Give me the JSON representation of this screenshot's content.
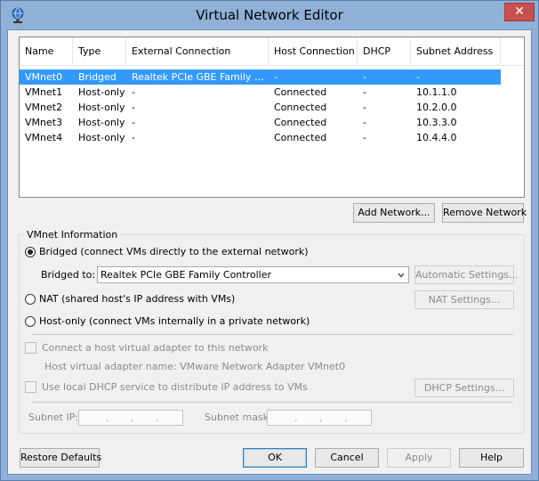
{
  "window": {
    "title": "Virtual Network Editor",
    "close_glyph": "✕"
  },
  "list": {
    "headers": [
      "Name",
      "Type",
      "External Connection",
      "Host Connection",
      "DHCP",
      "Subnet Address"
    ],
    "rows": [
      [
        "VMnet0",
        "Bridged",
        "Realtek PCIe GBE Family Co...",
        "-",
        "-",
        "-"
      ],
      [
        "VMnet1",
        "Host-only",
        "-",
        "Connected",
        "-",
        "10.1.1.0"
      ],
      [
        "VMnet2",
        "Host-only",
        "-",
        "Connected",
        "-",
        "10.2.0.0"
      ],
      [
        "VMnet3",
        "Host-only",
        "-",
        "Connected",
        "-",
        "10.3.3.0"
      ],
      [
        "VMnet4",
        "Host-only",
        "-",
        "Connected",
        "-",
        "10.4.4.0"
      ]
    ],
    "selected_row": 0
  },
  "buttons": {
    "add_network": "Add Network...",
    "remove_network": "Remove Network",
    "restore_defaults": "Restore Defaults",
    "ok": "OK",
    "cancel": "Cancel",
    "apply": "Apply",
    "help": "Help"
  },
  "vmnet_info": {
    "label": "VMnet Information",
    "bridged_label": "Bridged (connect VMs directly to the external network)",
    "bridged_to_label": "Bridged to:",
    "bridged_to_value": "Realtek PCIe GBE Family Controller",
    "automatic_settings": "Automatic Settings...",
    "nat_label": "NAT (shared host's IP address with VMs)",
    "nat_settings": "NAT Settings...",
    "hostonly_label": "Host-only (connect VMs internally in a private network)",
    "connect_adapter_label": "Connect a host virtual adapter to this network",
    "adapter_name_label": "Host virtual adapter name: VMware Network Adapter VMnet0",
    "dhcp_label": "Use local DHCP service to distribute IP address to VMs",
    "dhcp_settings": "DHCP Settings...",
    "subnet_ip_label": "Subnet IP:",
    "subnet_mask_label": "Subnet mask:",
    "selected_mode": "bridged"
  },
  "colors": {
    "selection": "#3399ff",
    "title_bg": "#8fb1d8",
    "close_bg": "#c75050"
  }
}
